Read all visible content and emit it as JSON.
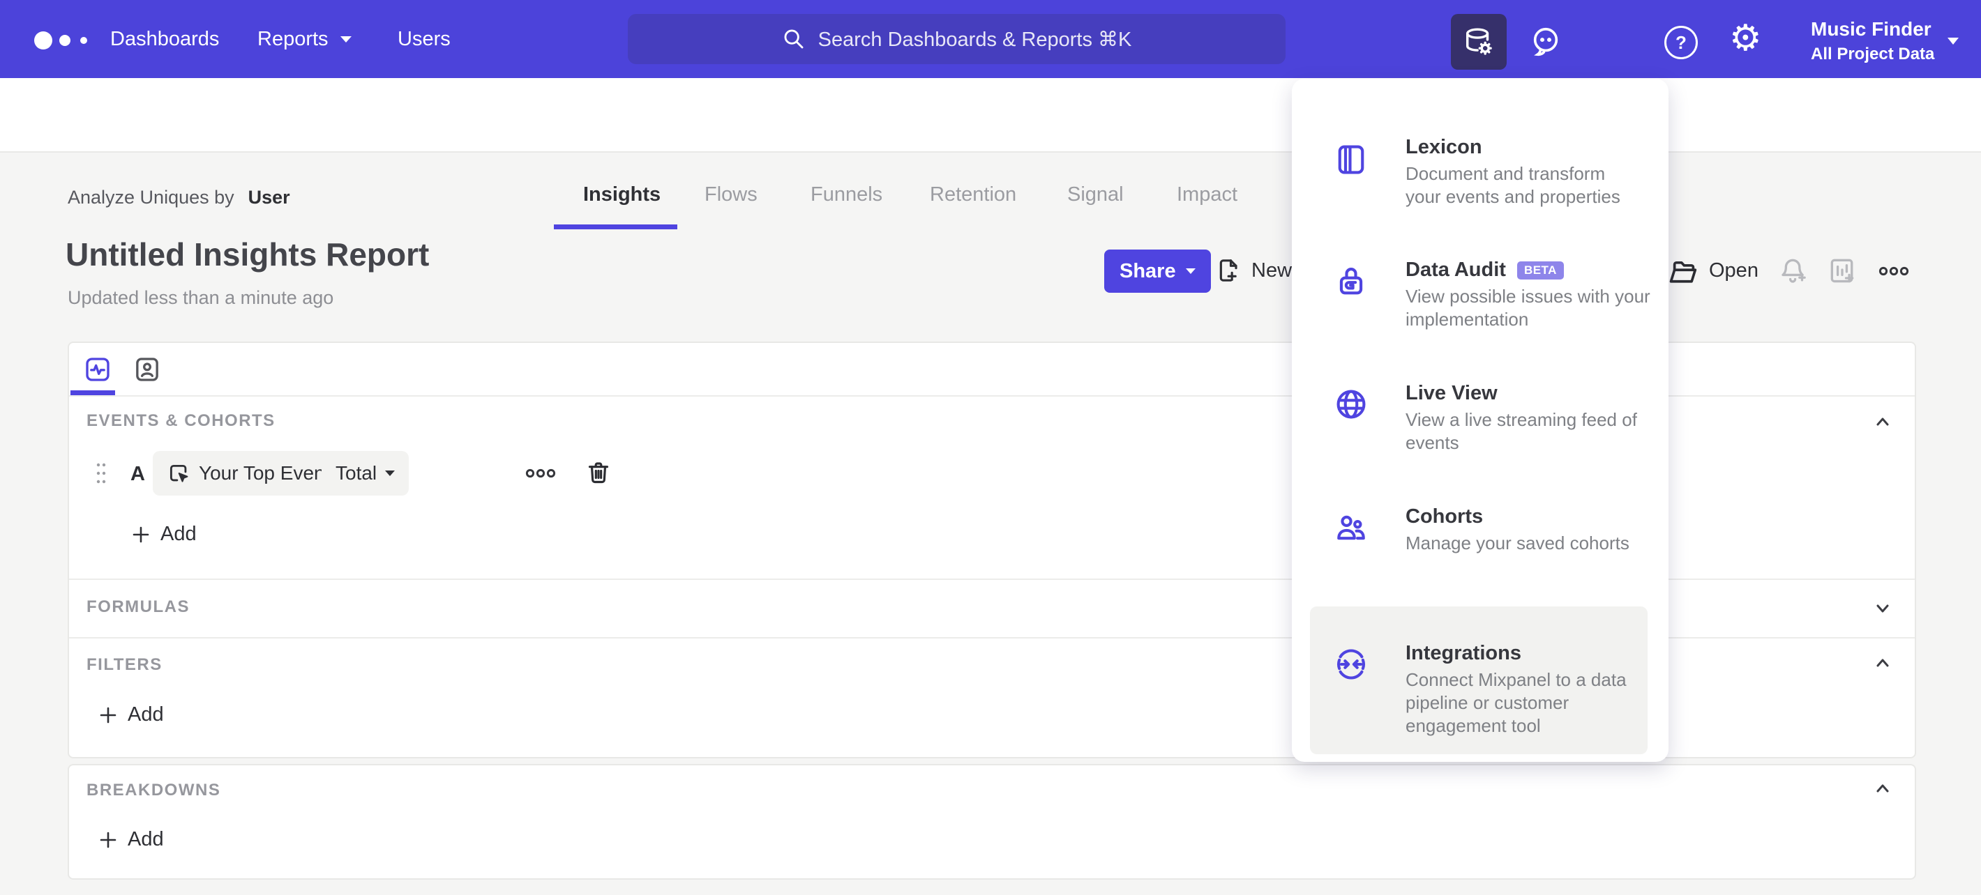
{
  "nav": {
    "items": [
      {
        "label": "Dashboards"
      },
      {
        "label": "Reports"
      },
      {
        "label": "Users"
      }
    ],
    "search_placeholder": "Search Dashboards & Reports ⌘K",
    "project": {
      "name": "Music Finder",
      "scope": "All Project Data"
    },
    "icons": [
      "data-management-icon",
      "feedback-icon",
      "apps-grid-icon",
      "help-icon",
      "settings-icon"
    ]
  },
  "tabs": {
    "items": [
      {
        "label": "Insights",
        "active": true
      },
      {
        "label": "Flows",
        "active": false
      },
      {
        "label": "Funnels",
        "active": false
      },
      {
        "label": "Retention",
        "active": false
      },
      {
        "label": "Signal",
        "active": false
      },
      {
        "label": "Impact",
        "active": false
      }
    ]
  },
  "report": {
    "breadcrumb_prefix": "Analyze Uniques by",
    "breadcrumb_value": "User",
    "title": "Untitled Insights Report",
    "updated": "Updated less than a minute ago",
    "share_label": "Share",
    "new_label": "New",
    "open_label": "Open"
  },
  "builder": {
    "events": {
      "label": "EVENTS & COHORTS",
      "row": {
        "letter": "A",
        "event": "Your Top Events",
        "metric": "Total"
      },
      "add_label": "Add"
    },
    "formulas": {
      "label": "FORMULAS"
    },
    "filters": {
      "label": "FILTERS",
      "add_label": "Add"
    },
    "breakdowns": {
      "label": "BREAKDOWNS",
      "add_label": "Add"
    }
  },
  "menu": {
    "items": [
      {
        "title": "Lexicon",
        "desc_lines": [
          "Document and transform",
          "your events and properties"
        ]
      },
      {
        "title": "Data Audit",
        "badge": "BETA",
        "desc_lines": [
          "View possible issues with your",
          "implementation"
        ]
      },
      {
        "title": "Live View",
        "desc_lines": [
          "View a live streaming feed of",
          "events"
        ]
      },
      {
        "title": "Cohorts",
        "desc_lines": [
          "Manage your saved cohorts"
        ]
      },
      {
        "title": "Integrations",
        "desc_lines": [
          "Connect Mixpanel to a data",
          "pipeline or customer",
          "engagement tool"
        ],
        "highlighted": true
      }
    ]
  },
  "colors": {
    "accent": "#4F44E0",
    "nav_bg": "#4C43DA",
    "beta_badge": "#8E85EA"
  }
}
